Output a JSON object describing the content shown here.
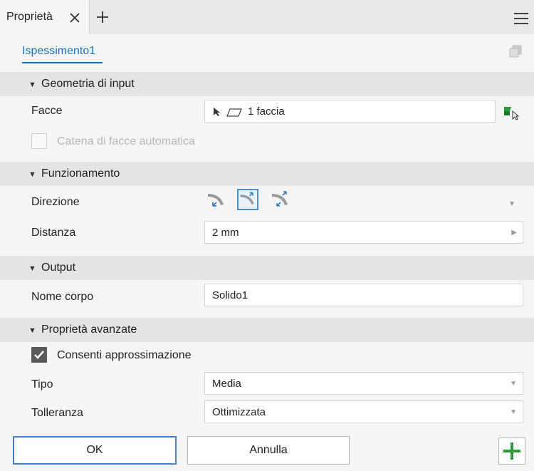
{
  "tab": {
    "label": "Proprietà",
    "close_icon": "close-icon",
    "add_icon": "plus-icon"
  },
  "header": {
    "feature_name": "Ispessimento1"
  },
  "sections": {
    "input": {
      "title": "Geometria di input",
      "facce_label": "Facce",
      "facce_value": "1 faccia",
      "chain_label": "Catena di facce automatica"
    },
    "operation": {
      "title": "Funzionamento",
      "direction_label": "Direzione",
      "distance_label": "Distanza",
      "distance_value": "2 mm"
    },
    "output": {
      "title": "Output",
      "body_name_label": "Nome corpo",
      "body_name_value": "Solido1"
    },
    "advanced": {
      "title": "Proprietà avanzate",
      "approx_label": "Consenti approssimazione",
      "type_label": "Tipo",
      "type_value": "Media",
      "tolerance_label": "Tolleranza",
      "tolerance_value": "Ottimizzata"
    }
  },
  "footer": {
    "ok_label": "OK",
    "cancel_label": "Annulla"
  },
  "colors": {
    "accent": "#1a73c9",
    "green": "#2a9d3a",
    "section_bg": "#e4e4e4"
  }
}
